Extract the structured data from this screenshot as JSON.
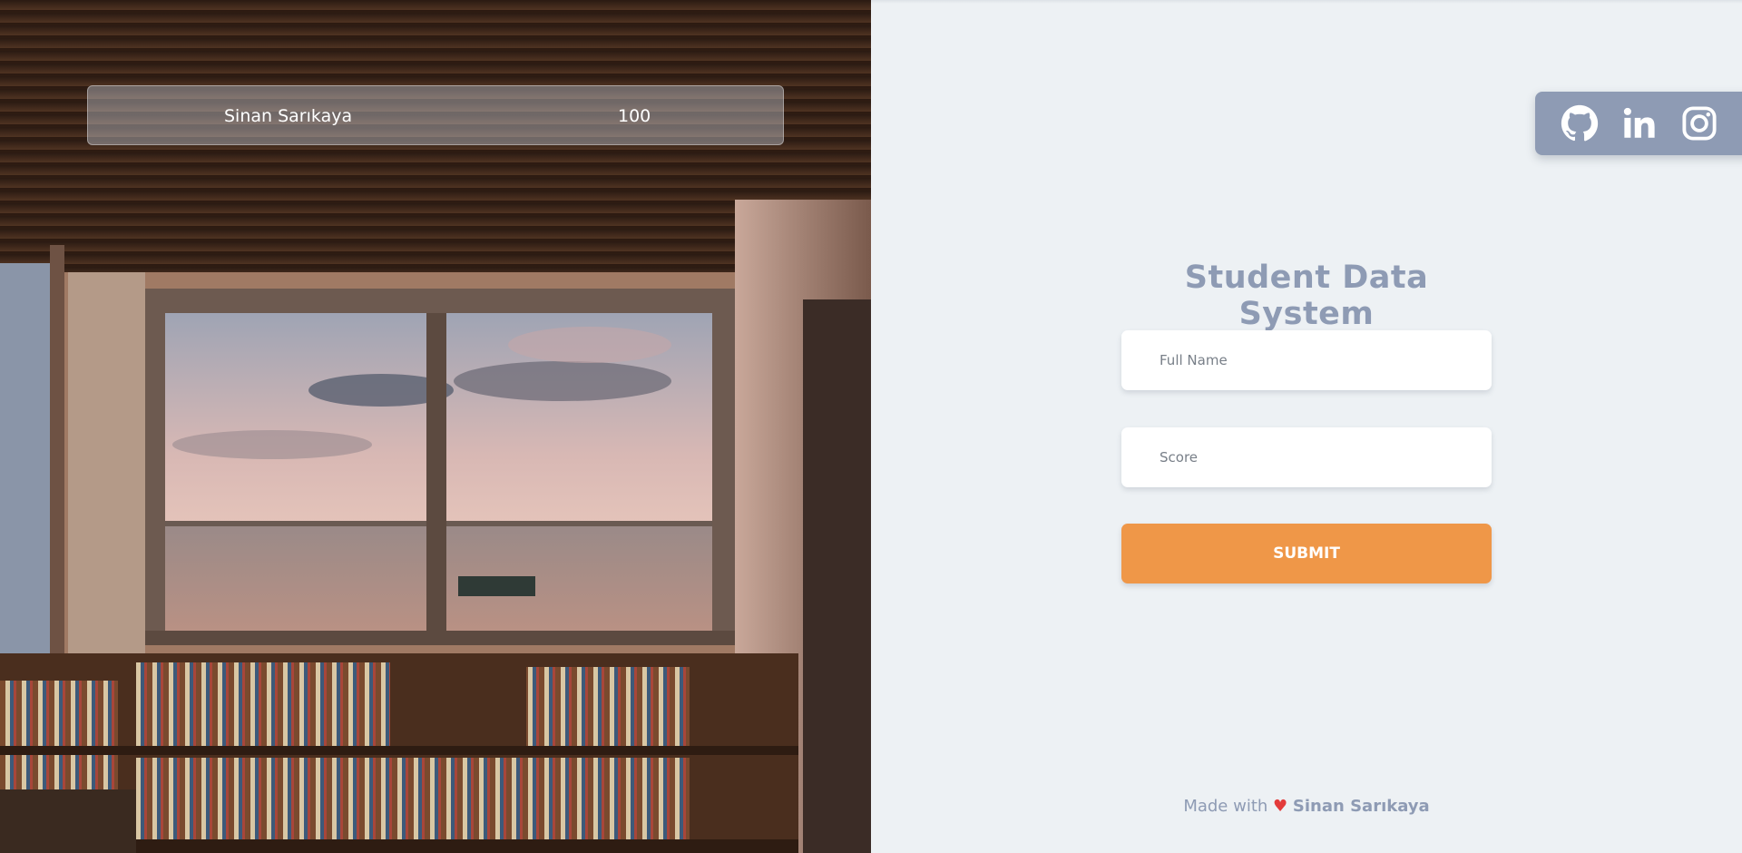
{
  "records": [
    {
      "name": "Sinan Sarıkaya",
      "score": "100"
    }
  ],
  "social": [
    {
      "icon": "github-icon",
      "label": "GitHub"
    },
    {
      "icon": "linkedin-icon",
      "label": "LinkedIn"
    },
    {
      "icon": "instagram-icon",
      "label": "Instagram"
    }
  ],
  "form": {
    "title": "Student Data System",
    "name_placeholder": "Full Name",
    "score_placeholder": "Score",
    "submit_label": "SUBMIT"
  },
  "footer": {
    "prefix": "Made with",
    "heart": "♥",
    "author": "Sinan Sarıkaya"
  },
  "colors": {
    "accent": "#ef9748",
    "muted": "#8e9bb4",
    "background": "#edf1f4",
    "heart": "#e33b3b"
  }
}
